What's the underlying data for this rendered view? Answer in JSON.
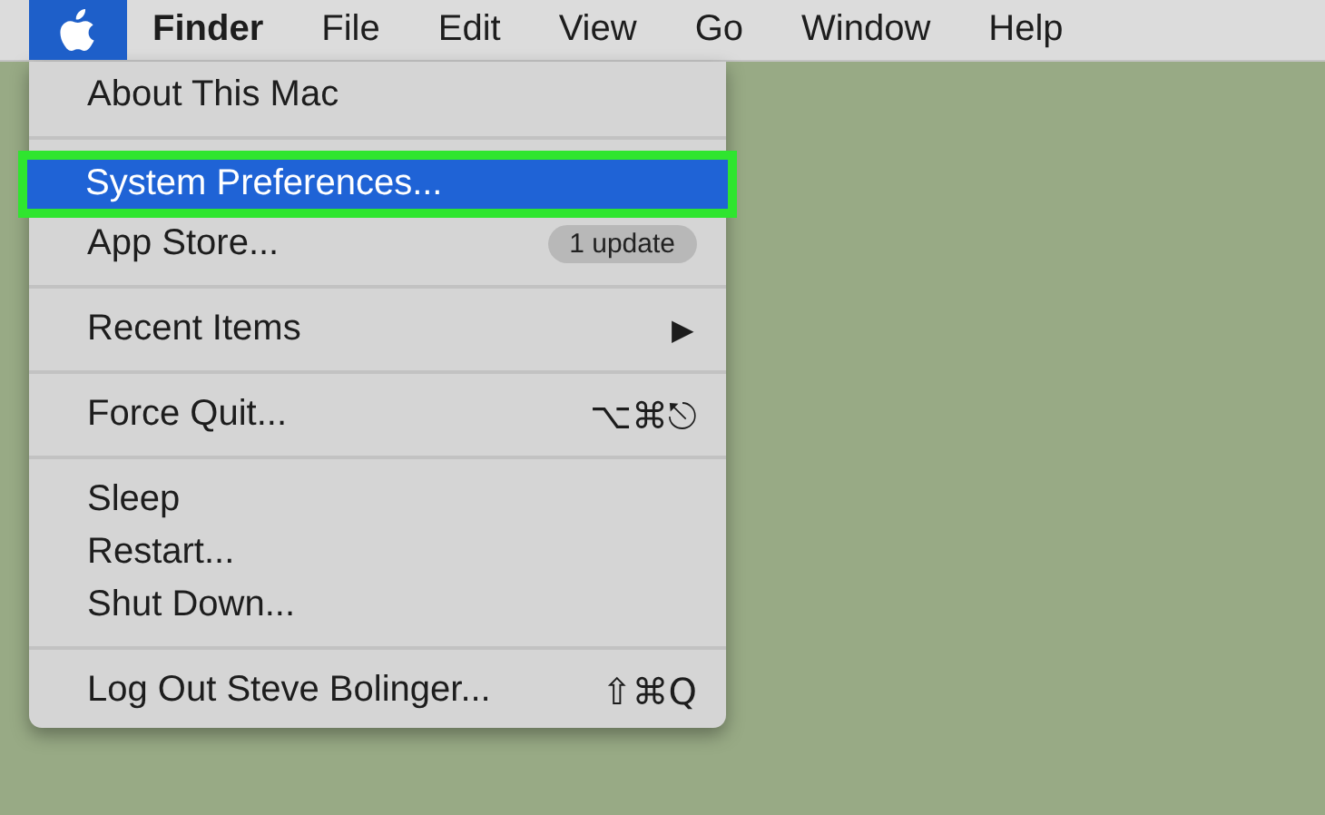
{
  "menu_bar": {
    "apple_menu": {
      "selected": true
    },
    "items": [
      {
        "label": "Finder",
        "kind": "app"
      },
      {
        "label": "File",
        "kind": "menu"
      },
      {
        "label": "Edit",
        "kind": "menu"
      },
      {
        "label": "View",
        "kind": "menu"
      },
      {
        "label": "Go",
        "kind": "menu"
      },
      {
        "label": "Window",
        "kind": "menu"
      },
      {
        "label": "Help",
        "kind": "menu"
      }
    ]
  },
  "apple_menu": {
    "groups": [
      [
        {
          "label": "About This Mac",
          "selected": false
        }
      ],
      [
        {
          "label": "System Preferences...",
          "selected": true,
          "annotated": true
        },
        {
          "label": "App Store...",
          "selected": false,
          "badge": "1 update"
        }
      ],
      [
        {
          "label": "Recent Items",
          "selected": false,
          "submenu": "▶"
        }
      ],
      [
        {
          "label": "Force Quit...",
          "selected": false,
          "shortcut": "⌥⌘⎋"
        }
      ],
      [
        {
          "label": "Sleep",
          "selected": false
        },
        {
          "label": "Restart...",
          "selected": false
        },
        {
          "label": "Shut Down...",
          "selected": false
        }
      ],
      [
        {
          "label": "Log Out Steve Bolinger...",
          "selected": false,
          "shortcut": "⇧⌘Q"
        }
      ]
    ]
  }
}
